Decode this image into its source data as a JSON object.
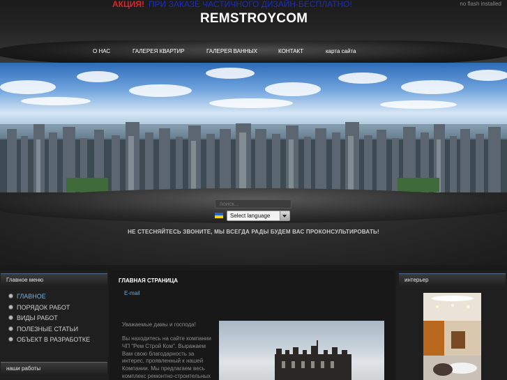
{
  "promo": {
    "label": "АКЦИЯ!",
    "text": "ПРИ ЗАКАЗЕ ЧАСТИЧНОГО ДИЗАЙН-БЕСПЛАТНО!"
  },
  "flash_notice": "no flash installed",
  "site_title": "REMSTROYCOM",
  "nav": [
    {
      "label": "О НАС"
    },
    {
      "label": "ГАЛЕРЕЯ КВАРТИР"
    },
    {
      "label": "ГАЛЕРЕЯ ВАННЫХ"
    },
    {
      "label": "КОНТАКТ"
    },
    {
      "label": "карта сайта"
    }
  ],
  "search": {
    "placeholder": "поиск..."
  },
  "language": {
    "selected": "Select language",
    "flag": "ukraine-flag"
  },
  "slogan": "НЕ СТЕСНЯЙТЕСЬ ЗВОНИТЕ, МЫ ВСЕГДА РАДЫ БУДЕМ ВАС ПРОКОНСУЛЬТИРОВАТЬ!",
  "left_menu": {
    "title": "Главное меню",
    "items": [
      {
        "label": "ГЛАВНОЕ",
        "active": true
      },
      {
        "label": "ПОРЯДОК РАБОТ"
      },
      {
        "label": "ВИДЫ РАБОТ"
      },
      {
        "label": "ПОЛЕЗНЫЕ СТАТЬИ"
      },
      {
        "label": "ОБЪЕКТ В РАЗРАБОТКЕ"
      }
    ],
    "second_title": "наши работы"
  },
  "main": {
    "title": "ГЛАВНАЯ СТРАНИЦА",
    "email_link": "E-mail",
    "lines": [
      "Уважаемые дамы и господа!",
      "Вы находитесь на сайте компании",
      "ЧП \"Рем Строй Ком\". Выражаем",
      "Вам свою благодарность за",
      "интерес, проявленный к нашей",
      "Компании. Мы предлагаем весь",
      "комплекс ремонтно-строительных"
    ]
  },
  "right_panel": {
    "title": "интерьер"
  },
  "colors": {
    "accent": "#6fb2e8",
    "promo_red": "#e0232b",
    "promo_blue": "#1c2cc4"
  }
}
